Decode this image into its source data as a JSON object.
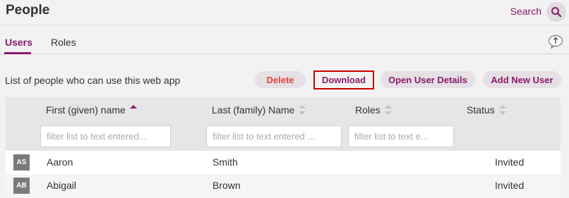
{
  "header": {
    "title": "People",
    "search_label": "Search"
  },
  "tabs": [
    {
      "label": "Users",
      "active": true
    },
    {
      "label": "Roles",
      "active": false
    }
  ],
  "toolbar": {
    "caption": "List of people who can use this web app",
    "delete_label": "Delete",
    "download_label": "Download",
    "open_details_label": "Open User Details",
    "add_user_label": "Add New User"
  },
  "table": {
    "columns": [
      {
        "label": "First (given) name",
        "sort": "ascending",
        "filter_placeholder": "filter list to text entered..."
      },
      {
        "label": "Last (family) Name",
        "sort": "none",
        "filter_placeholder": "filter list to text entered ..."
      },
      {
        "label": "Roles",
        "sort": "none",
        "filter_placeholder": "filter list to text e..."
      },
      {
        "label": "Status",
        "sort": "none"
      }
    ],
    "rows": [
      {
        "initials": "AS",
        "first": "Aaron",
        "last": "Smith",
        "roles": "",
        "status": "Invited"
      },
      {
        "initials": "AB",
        "first": "Abigail",
        "last": "Brown",
        "roles": "",
        "status": "Invited"
      }
    ]
  },
  "colors": {
    "accent": "#8b1a6b",
    "danger": "#e2463c",
    "highlight_border": "#c80000"
  },
  "icons": [
    "search-icon",
    "upload-icon",
    "sort-ascending-icon",
    "sort-neutral-icon"
  ]
}
